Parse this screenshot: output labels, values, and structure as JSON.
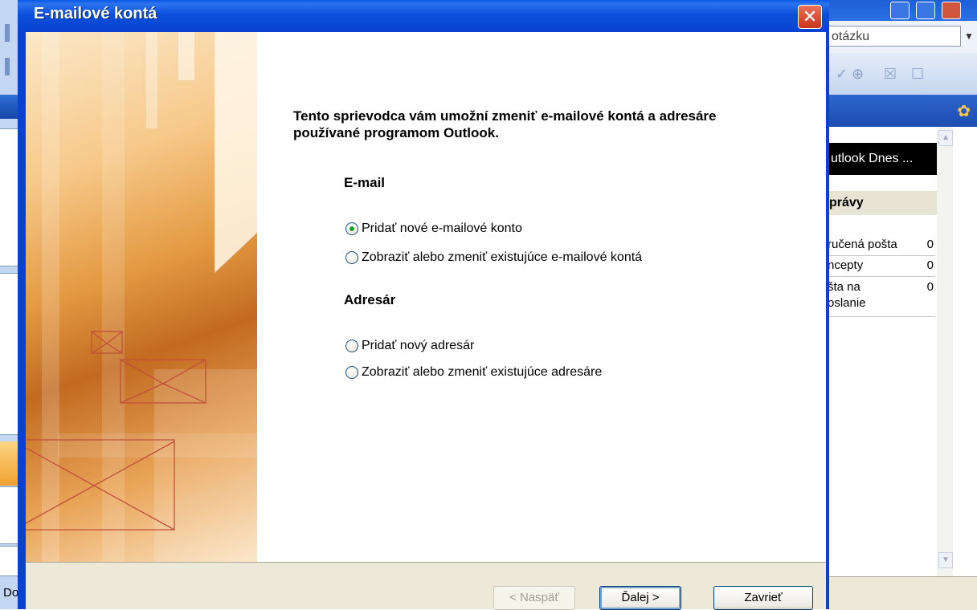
{
  "dialog": {
    "title": "E-mailové kontá",
    "intro": "Tento sprievodca vám umožní zmeniť e-mailové kontá a adresáre používané programom Outlook.",
    "email_section": {
      "heading": "E-mail",
      "options": [
        {
          "label": "Pridať nové e-mailové konto",
          "checked": true
        },
        {
          "label": "Zobraziť alebo zmeniť existujúce e-mailové kontá",
          "checked": false
        }
      ]
    },
    "address_section": {
      "heading": "Adresár",
      "options": [
        {
          "label": "Pridať nový adresár",
          "checked": false
        },
        {
          "label": "Zobraziť alebo zmeniť existujúce adresáre",
          "checked": false
        }
      ]
    },
    "buttons": {
      "back": "< Naspäť",
      "next": "Ďalej >",
      "close": "Zavrieť"
    }
  },
  "background": {
    "help_box_text": "otázku",
    "outlook_today": "utlook Dnes ...",
    "messages_heading": "právy",
    "folders": [
      {
        "name": "ručená pošta",
        "count": "0"
      },
      {
        "name": "ncepty",
        "count": "0"
      },
      {
        "name_line1": "šta na",
        "name_line2": "oslanie",
        "count": "0"
      }
    ],
    "status_left": "Do"
  }
}
